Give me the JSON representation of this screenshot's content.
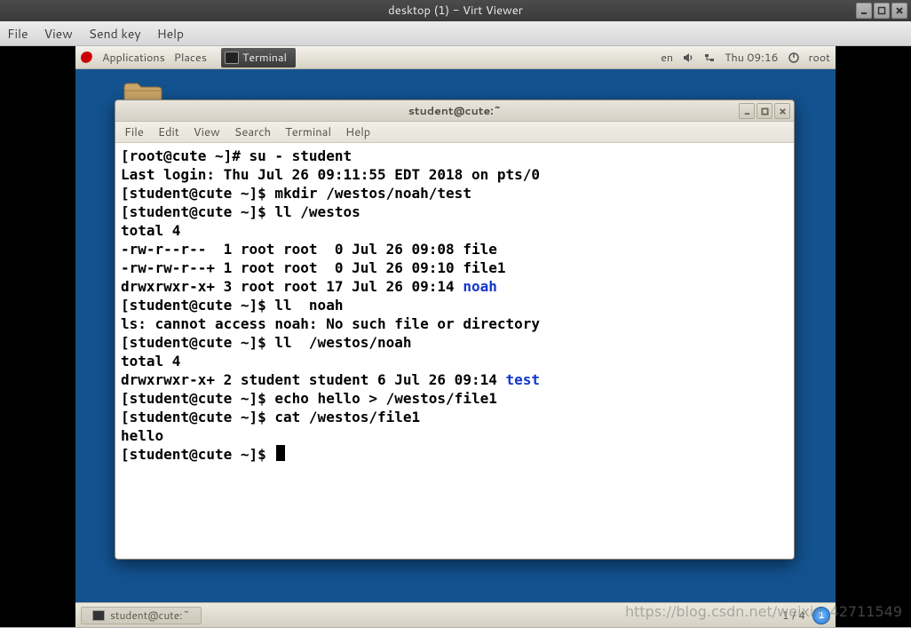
{
  "outer": {
    "title": "desktop (1) - Virt Viewer",
    "menu": {
      "file": "File",
      "view": "View",
      "sendkey": "Send key",
      "help": "Help"
    }
  },
  "gnome_top": {
    "applications": "Applications",
    "places": "Places",
    "active_app": "Terminal",
    "lang": "en",
    "clock": "Thu 09:16",
    "user": "root"
  },
  "terminal_window": {
    "title": "student@cute:~",
    "menu": {
      "file": "File",
      "edit": "Edit",
      "view": "View",
      "search": "Search",
      "terminal": "Terminal",
      "help": "Help"
    }
  },
  "terminal_lines": [
    {
      "segs": [
        {
          "t": "[root@cute ~]# su - student"
        }
      ]
    },
    {
      "segs": [
        {
          "t": "Last login: Thu Jul 26 09:11:55 EDT 2018 on pts/0"
        }
      ]
    },
    {
      "segs": [
        {
          "t": "[student@cute ~]$ mkdir /westos/noah/test"
        }
      ]
    },
    {
      "segs": [
        {
          "t": "[student@cute ~]$ ll /westos"
        }
      ]
    },
    {
      "segs": [
        {
          "t": "total 4"
        }
      ]
    },
    {
      "segs": [
        {
          "t": "-rw-r--r--  1 root root  0 Jul 26 09:08 file"
        }
      ]
    },
    {
      "segs": [
        {
          "t": "-rw-rw-r--+ 1 root root  0 Jul 26 09:10 file1"
        }
      ]
    },
    {
      "segs": [
        {
          "t": "drwxrwxr-x+ 3 root root 17 Jul 26 09:14 "
        },
        {
          "t": "noah",
          "cls": "dir-blue"
        }
      ]
    },
    {
      "segs": [
        {
          "t": "[student@cute ~]$ ll  noah"
        }
      ]
    },
    {
      "segs": [
        {
          "t": "ls: cannot access noah: No such file or directory"
        }
      ]
    },
    {
      "segs": [
        {
          "t": "[student@cute ~]$ ll  /westos/noah"
        }
      ]
    },
    {
      "segs": [
        {
          "t": "total 4"
        }
      ]
    },
    {
      "segs": [
        {
          "t": "drwxrwxr-x+ 2 student student 6 Jul 26 09:14 "
        },
        {
          "t": "test",
          "cls": "dir-blue"
        }
      ]
    },
    {
      "segs": [
        {
          "t": "[student@cute ~]$ echo hello > /westos/file1"
        }
      ]
    },
    {
      "segs": [
        {
          "t": "[student@cute ~]$ cat /westos/file1"
        }
      ]
    },
    {
      "segs": [
        {
          "t": "hello"
        }
      ]
    },
    {
      "segs": [
        {
          "t": "[student@cute ~]$ "
        }
      ],
      "cursor": true
    }
  ],
  "taskbar": {
    "item_label": "student@cute:~",
    "workspace": "1 / 4",
    "ws_badge": "1"
  },
  "watermark": "https://blog.csdn.net/weixin_42711549"
}
